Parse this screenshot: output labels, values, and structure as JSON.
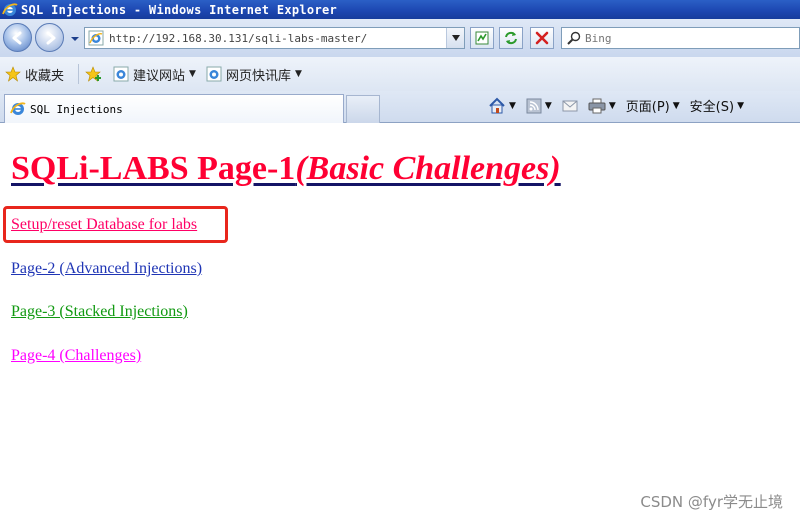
{
  "window": {
    "title": "SQL Injections - Windows Internet Explorer"
  },
  "navigation": {
    "address": "http://192.168.30.131/sqli-labs-master/",
    "search_placeholder": "Bing"
  },
  "favorites_bar": {
    "favorites_label": "收藏夹",
    "items": [
      {
        "label": "建议网站"
      },
      {
        "label": "网页快讯库"
      }
    ]
  },
  "tab": {
    "label": "SQL Injections"
  },
  "command_bar": {
    "page_label": "页面(P)",
    "safety_label": "安全(S)"
  },
  "page": {
    "heading_main": "SQLi-LABS Page-1",
    "heading_italic": "(Basic Challenges)",
    "links": [
      {
        "label": "Setup/reset Database for labs",
        "color": "#ff0066"
      },
      {
        "label": "Page-2 (Advanced Injections)",
        "color": "#1f35b5"
      },
      {
        "label": "Page-3 (Stacked Injections)",
        "color": "#109910"
      },
      {
        "label": "Page-4 (Challenges)",
        "color": "#ff00ff"
      }
    ],
    "highlight_color": "#e8261c"
  },
  "watermark": "CSDN @fyr学无止境"
}
